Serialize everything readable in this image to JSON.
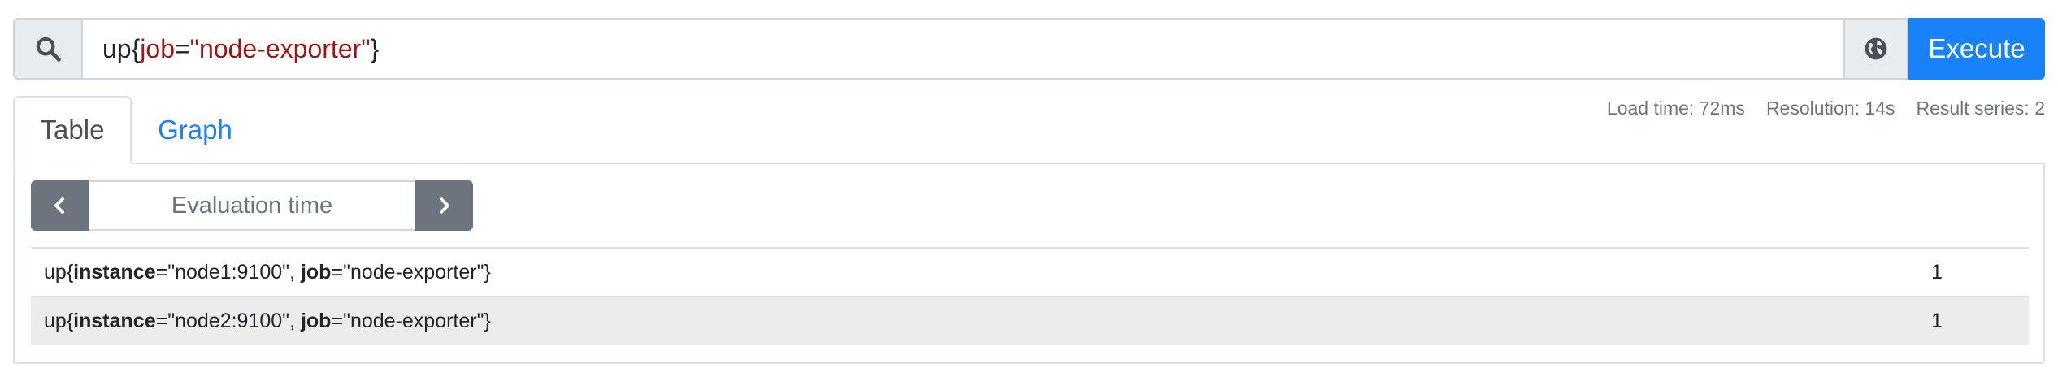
{
  "query": {
    "metric": "up",
    "label_name": "job",
    "label_value": "\"node-exporter\"",
    "execute_label": "Execute"
  },
  "tabs": [
    {
      "label": "Table",
      "active": true
    },
    {
      "label": "Graph",
      "active": false
    }
  ],
  "stats": {
    "load_time": "Load time: 72ms",
    "resolution": "Resolution: 14s",
    "result_series": "Result series: 2"
  },
  "evaluation": {
    "placeholder": "Evaluation time"
  },
  "results": [
    {
      "metric": "up",
      "labels": [
        {
          "name": "instance",
          "value": "\"node1:9100\""
        },
        {
          "name": "job",
          "value": "\"node-exporter\""
        }
      ],
      "value": "1"
    },
    {
      "metric": "up",
      "labels": [
        {
          "name": "instance",
          "value": "\"node2:9100\""
        },
        {
          "name": "job",
          "value": "\"node-exporter\""
        }
      ],
      "value": "1"
    }
  ],
  "colors": {
    "primary": "#1a82f7",
    "secondary": "#6c757d",
    "label_red": "#a31515",
    "stripe": "#ececec"
  },
  "icons": {
    "search": "search-icon",
    "explain": "globe-icon",
    "prev": "chevron-left-icon",
    "next": "chevron-right-icon"
  }
}
